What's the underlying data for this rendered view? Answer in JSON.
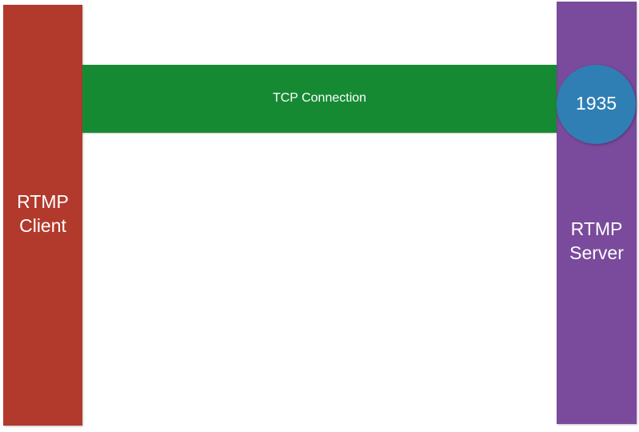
{
  "client": {
    "line1": "RTMP",
    "line2": "Client",
    "color": "#b23a2c"
  },
  "server": {
    "line1": "RTMP",
    "line2": "Server",
    "color": "#7a4a9c"
  },
  "connection": {
    "label": "TCP Connection",
    "color": "#168a33"
  },
  "port": {
    "label": "1935",
    "color": "#2f7fb5"
  }
}
